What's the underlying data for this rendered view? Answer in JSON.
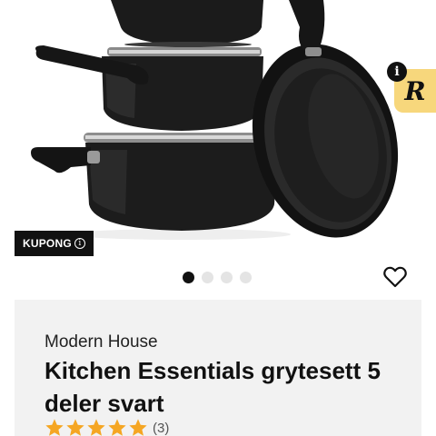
{
  "product": {
    "brand": "Modern House",
    "title": "Kitchen Essentials grytesett 5 deler svart",
    "rating": 5,
    "rating_count_label": "(3)"
  },
  "coupon": {
    "label": "KUPONG"
  },
  "badge": {
    "letter": "R",
    "info_symbol": "i"
  },
  "gallery": {
    "image_count": 4,
    "active_index": 0
  },
  "colors": {
    "badge_bg": "#f7d77c",
    "star": "#f5a623",
    "panel_bg": "#f2f2f2",
    "coupon_bg": "#111111"
  }
}
